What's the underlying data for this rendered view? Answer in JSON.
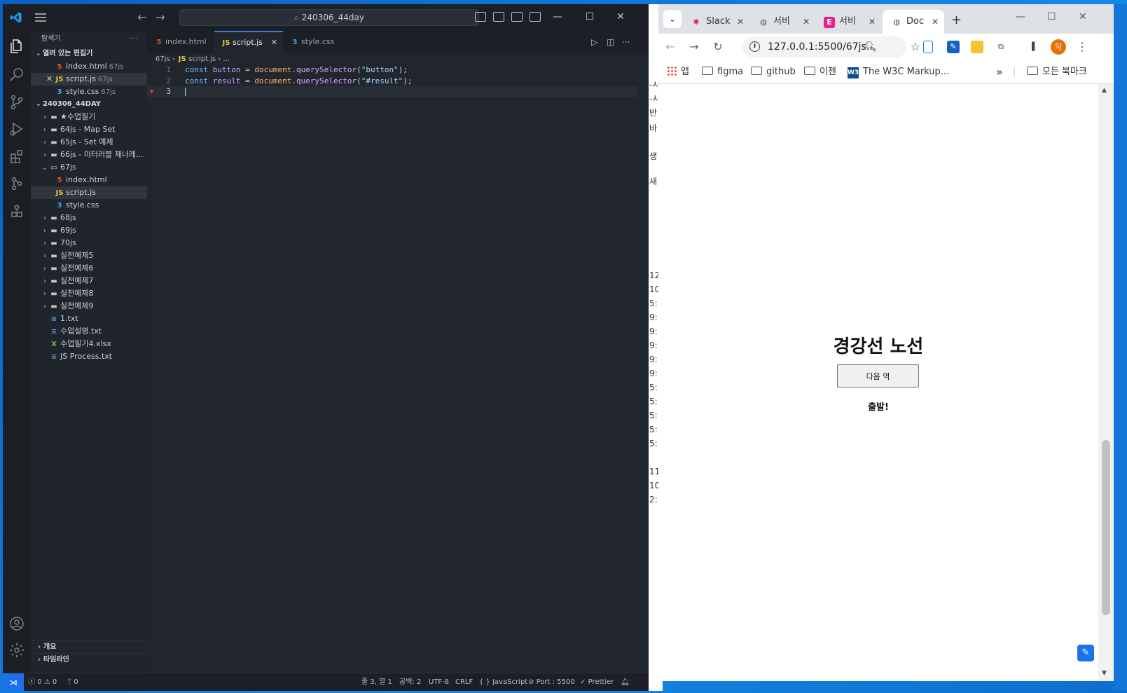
{
  "vscode": {
    "title_search": "240306_44day",
    "tabs": [
      {
        "label": "index.html"
      },
      {
        "label": "script.js"
      },
      {
        "label": "style.css"
      }
    ],
    "breadcrumb": [
      "67js",
      "script.js",
      "..."
    ],
    "explorer": {
      "header": "탐색기",
      "open_editors_title": "열려 있는 편집기",
      "open_editors": [
        {
          "name": "index.html",
          "desc": "67js"
        },
        {
          "name": "script.js",
          "desc": "67js"
        },
        {
          "name": "style.css",
          "desc": "67js"
        }
      ],
      "workspace_title": "240306_44DAY",
      "tree": [
        {
          "name": "★수업필기",
          "kind": "folder"
        },
        {
          "name": "64js - Map Set",
          "kind": "folder"
        },
        {
          "name": "65js - Set 예제",
          "kind": "folder"
        },
        {
          "name": "66js - 이터러블 제너레...",
          "kind": "folder"
        },
        {
          "name": "67js",
          "kind": "folder-open"
        },
        {
          "name": "index.html",
          "kind": "html"
        },
        {
          "name": "script.js",
          "kind": "js"
        },
        {
          "name": "style.css",
          "kind": "css"
        },
        {
          "name": "68js",
          "kind": "folder"
        },
        {
          "name": "69js",
          "kind": "folder"
        },
        {
          "name": "70js",
          "kind": "folder"
        },
        {
          "name": "실전예제5",
          "kind": "folder"
        },
        {
          "name": "실전예제6",
          "kind": "folder"
        },
        {
          "name": "실전예제7",
          "kind": "folder"
        },
        {
          "name": "실전예제8",
          "kind": "folder"
        },
        {
          "name": "실전예제9",
          "kind": "folder"
        },
        {
          "name": "1.txt",
          "kind": "txt"
        },
        {
          "name": "수업설명.txt",
          "kind": "txt"
        },
        {
          "name": "수업필기4.xlsx",
          "kind": "xls"
        },
        {
          "name": "JS Process.txt",
          "kind": "txt"
        }
      ],
      "outline_label": "개요",
      "timeline_label": "타임라인"
    },
    "code": {
      "line_numbers": [
        "1",
        "2",
        "3"
      ],
      "line1": {
        "kw": "const",
        "var": "button",
        "eq": " = ",
        "obj": "document",
        "fn": "querySelector",
        "str": "\"button\"",
        "end": ");"
      },
      "line2": {
        "kw": "const",
        "var": "result",
        "eq": " = ",
        "obj": "document",
        "fn": "querySelector",
        "str": "\"#result\"",
        "end": ");"
      }
    },
    "status": {
      "problems_errors": "0",
      "problems_warnings": "0",
      "ports": "0",
      "position": "줄 3, 열 1",
      "spaces": "공백: 2",
      "encoding": "UTF-8",
      "eol": "CRLF",
      "language": "JavaScript",
      "port": "Port : 5500",
      "formatter": "Prettier"
    }
  },
  "browser": {
    "tabs": [
      {
        "label": "Slack",
        "icon": "slack-icon"
      },
      {
        "label": "서비",
        "icon": "globe-icon"
      },
      {
        "label": "서비",
        "icon": "e-icon",
        "icon_text": "E"
      },
      {
        "label": "Doc",
        "icon": "globe-icon"
      }
    ],
    "address": "127.0.0.1:5500/67js...",
    "avatar": "SJ",
    "bookmarks": [
      {
        "label": "앱",
        "icon": "apps-icon"
      },
      {
        "label": "figma",
        "icon": "folder-icon"
      },
      {
        "label": "github",
        "icon": "folder-icon"
      },
      {
        "label": "이젠",
        "icon": "folder-icon"
      },
      {
        "label": "The W3C Markup...",
        "icon": "w3c-icon",
        "icon_text": "W3"
      }
    ],
    "bookmarks_more": "»",
    "all_bookmarks": "모든 북마크",
    "page": {
      "title": "경강선 노선",
      "button": "다음 역",
      "result": "출발!"
    }
  },
  "behind_window_fragments": [
    "-시",
    "-시",
    "반",
    "바",
    "생",
    "새",
    "12",
    "10",
    "5:",
    "9:",
    "9:",
    "9:",
    "9:",
    "9:",
    "5:",
    "5:",
    "5:",
    "5:",
    "5:",
    "11",
    "10",
    "2:"
  ],
  "colors": {
    "accent_blue": "#1f6feb",
    "editor_bg": "#21262d",
    "sidebar_bg": "#20252b",
    "chrome_avatar": "#e8710a"
  }
}
